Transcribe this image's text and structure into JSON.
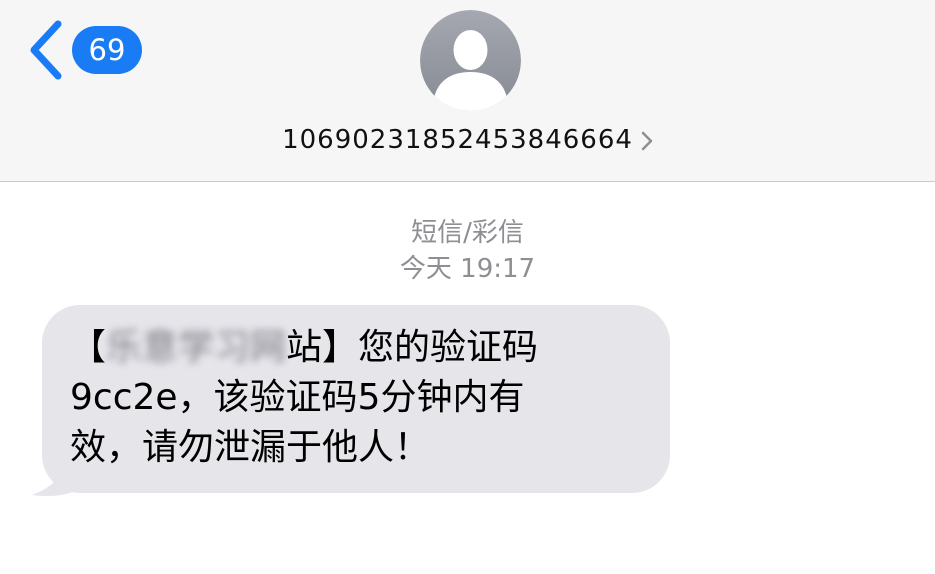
{
  "nav": {
    "unread_count": "69",
    "contact_number": "106902318524538466​64",
    "contact_display": "10690231852453846664"
  },
  "conversation": {
    "message_type": "短信/彩信",
    "timestamp": "今天 19:17"
  },
  "message": {
    "bracket_open": "【",
    "sender_redacted": "乐意学习网",
    "sender_visible_tail": "站",
    "line1_rest": "】您的验证码",
    "line2": "9cc2e，该验证码5分钟内有",
    "line3": "效，请勿泄漏于他人！"
  },
  "colors": {
    "accent": "#1a7cf5",
    "header_bg": "#f6f6f6",
    "bubble_bg": "#e5e5ea",
    "meta_text": "#8e8e93"
  },
  "icons": {
    "back": "chevron-left-icon",
    "avatar": "person-silhouette-icon",
    "contact_detail": "chevron-right-icon"
  }
}
